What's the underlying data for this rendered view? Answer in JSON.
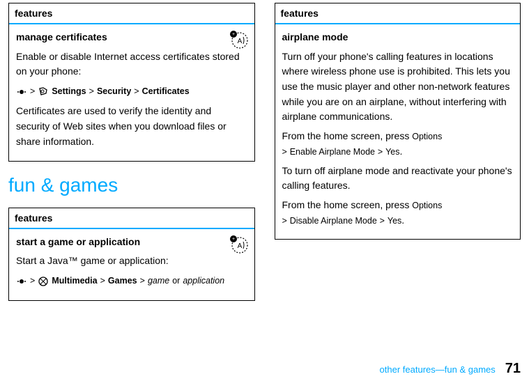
{
  "left": {
    "box1": {
      "header": "features",
      "title": "manage certificates",
      "body1": "Enable or disable Internet access certificates stored on your phone:",
      "settings": "Settings",
      "security": "Security",
      "certificates": "Certificates",
      "body2": "Certificates are used to verify the identity and security of Web sites when you download files or share information."
    },
    "heading": "fun & games",
    "box2": {
      "header": "features",
      "title": "start a game or application",
      "body1": "Start a Java™ game or application:",
      "multimedia": "Multimedia",
      "games": "Games",
      "gameOr": "game",
      "or": "or",
      "application": "application"
    }
  },
  "right": {
    "box": {
      "header": "features",
      "title": "airplane mode",
      "body1": "Turn off your phone's calling features in locations where wireless phone use is prohibited. This lets you use the music player and other non-network features while you are on an airplane, without interfering with airplane communications.",
      "body2a": "From the home screen, press ",
      "options": "Options",
      "enable": "Enable Airplane Mode",
      "yes": "Yes",
      "body3": "To turn off airplane mode and reactivate your phone's calling features.",
      "body4a": "From the home screen, press ",
      "disable": "Disable Airplane Mode"
    }
  },
  "footer": {
    "label": "other features—fun & games",
    "page": "71"
  },
  "glyphs": {
    "gt": ">",
    "period": "."
  }
}
